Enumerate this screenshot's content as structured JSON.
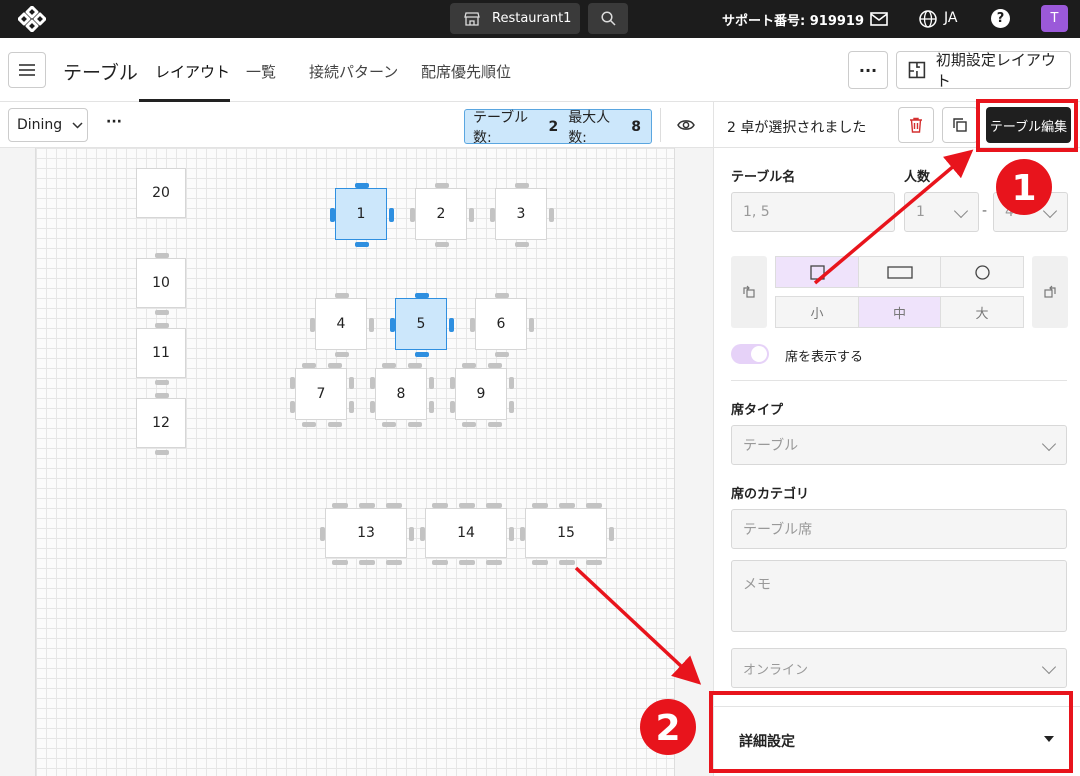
{
  "topbar": {
    "store_name": "Restaurant1",
    "support_label": "サポート番号: 919919",
    "language": "JA",
    "help_glyph": "?",
    "avatar_initial": "T"
  },
  "header": {
    "title": "テーブル",
    "tabs": [
      {
        "label": "レイアウト",
        "active": true
      },
      {
        "label": "一覧",
        "active": false
      },
      {
        "label": "接続パターン",
        "active": false
      },
      {
        "label": "配席優先順位",
        "active": false
      }
    ],
    "more_label": "···",
    "default_layout_label": "初期設定レイアウト"
  },
  "toolbar": {
    "area": "Dining",
    "more_label": "···",
    "table_count_label": "テーブル数:",
    "table_count": "2",
    "max_people_label": "最大人数:",
    "max_people": "8"
  },
  "tables": [
    {
      "label": "20",
      "selected": false
    },
    {
      "label": "1",
      "selected": true
    },
    {
      "label": "2",
      "selected": false
    },
    {
      "label": "3",
      "selected": false
    },
    {
      "label": "10",
      "selected": false
    },
    {
      "label": "11",
      "selected": false
    },
    {
      "label": "4",
      "selected": false
    },
    {
      "label": "5",
      "selected": true
    },
    {
      "label": "6",
      "selected": false
    },
    {
      "label": "7",
      "selected": false
    },
    {
      "label": "8",
      "selected": false
    },
    {
      "label": "9",
      "selected": false
    },
    {
      "label": "12",
      "selected": false
    },
    {
      "label": "13",
      "selected": false
    },
    {
      "label": "14",
      "selected": false
    },
    {
      "label": "15",
      "selected": false
    }
  ],
  "panel": {
    "selection_text": "2 卓が選択されました",
    "edit_button": "テーブル編集",
    "table_name_label": "テーブル名",
    "table_name_value": "1, 5",
    "people_label": "人数",
    "people_min": "1",
    "people_sep": "-",
    "people_max": "4",
    "sizes": [
      "小",
      "中",
      "大"
    ],
    "selected_shape": "square",
    "selected_size": "中",
    "show_seats_label": "席を表示する",
    "show_seats_on": true,
    "seat_type_label": "席タイプ",
    "seat_type_value": "テーブル",
    "seat_category_label": "席のカテゴリ",
    "seat_category_placeholder": "テーブル席",
    "memo_placeholder": "メモ",
    "online_value": "オンライン",
    "details_label": "詳細設定"
  },
  "annotations": {
    "step1": "1",
    "step2": "2",
    "color": "#e8141c"
  },
  "colors": {
    "selected_fill": "#cce7fb",
    "selected_border": "#2e8fe0",
    "accent_purple": "#9b59d9",
    "topbar": "#1c1c1c"
  }
}
